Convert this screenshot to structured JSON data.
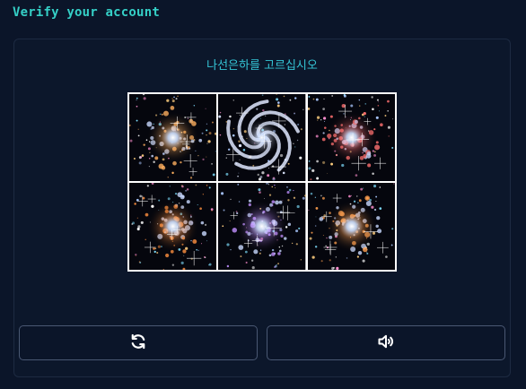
{
  "header": {
    "title": "Verify your account"
  },
  "challenge": {
    "prompt": "나선은하를 고르십시오",
    "tiles": [
      {
        "kind": "galaxy",
        "hue": "#ffb060"
      },
      {
        "kind": "spiral",
        "hue": "#dfe8ff"
      },
      {
        "kind": "galaxy",
        "hue": "#ff7070"
      },
      {
        "kind": "galaxy",
        "hue": "#ff9040"
      },
      {
        "kind": "galaxy",
        "hue": "#c090ff"
      },
      {
        "kind": "galaxy",
        "hue": "#ffa050"
      }
    ]
  },
  "controls": {
    "refresh_icon": "refresh-icon",
    "audio_icon": "speaker-icon"
  },
  "colors": {
    "background": "#0b1529",
    "accent": "#35d0c7",
    "prompt": "#35c6d6",
    "button_border": "#4a5873"
  }
}
